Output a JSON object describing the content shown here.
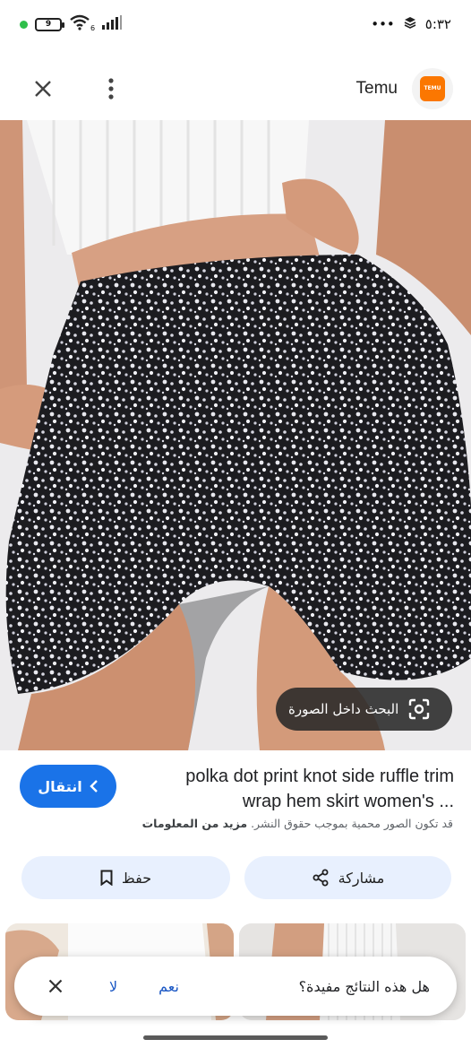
{
  "status_bar": {
    "battery": "9",
    "time": "٥:٣٢",
    "more": "•••",
    "network_badge": "6"
  },
  "header": {
    "title": "Temu",
    "logo_text": "TEMU"
  },
  "lens": {
    "label": "البحث داخل الصورة"
  },
  "result": {
    "visit_label": "انتقال",
    "title_line1": "polka dot print knot side ruffle trim",
    "title_line2": "wrap hem skirt women's ...",
    "copyright": "قد تكون الصور محمية بموجب حقوق النشر.",
    "more_info": "مزيد من المعلومات"
  },
  "actions": {
    "save_label": "حفظ",
    "share_label": "مشاركة"
  },
  "feedback": {
    "question": "هل هذه النتائج مفيدة؟",
    "yes": "نعم",
    "no": "لا"
  },
  "colors": {
    "accent": "#1a73e8",
    "button_bg": "#e8f0fe",
    "temu_orange": "#fb7701"
  }
}
